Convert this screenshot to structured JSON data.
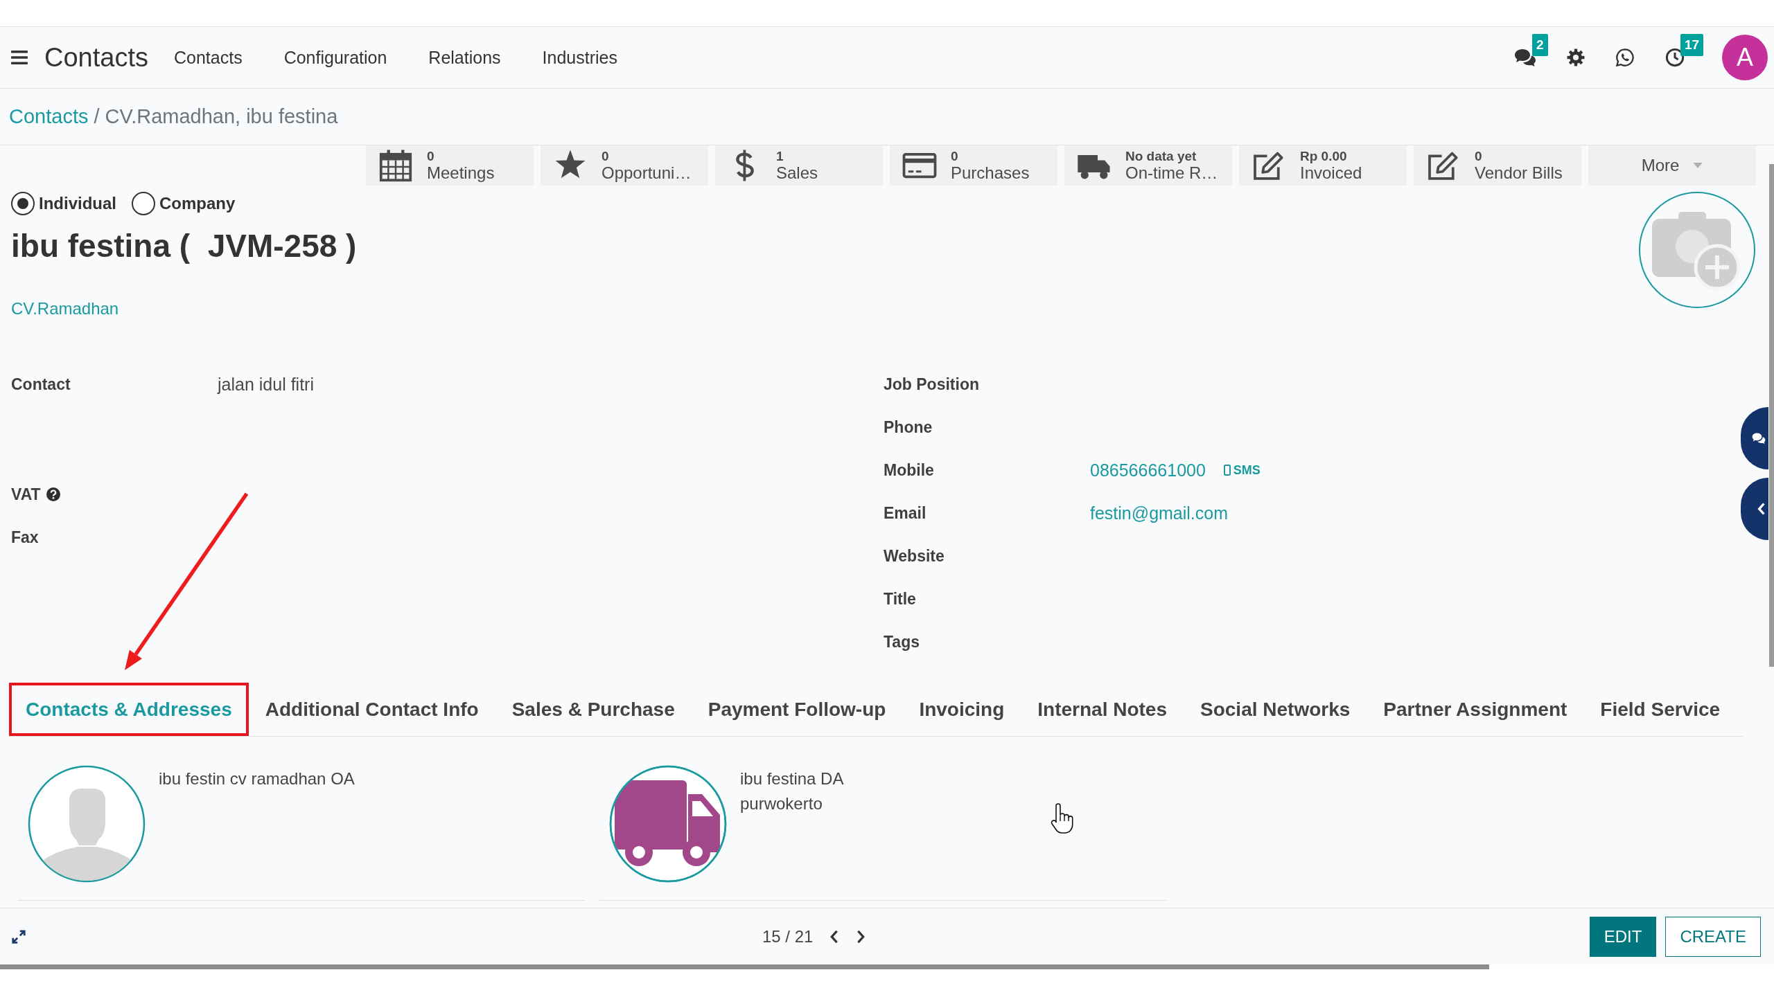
{
  "navbar": {
    "app_name": "Contacts",
    "menu": [
      "Contacts",
      "Configuration",
      "Relations",
      "Industries"
    ],
    "systray": [
      {
        "kind": "messages",
        "badge": "2"
      },
      {
        "kind": "settings"
      },
      {
        "kind": "whatsapp"
      },
      {
        "kind": "activities",
        "badge": "17"
      }
    ],
    "avatar": "A"
  },
  "breadcrumb": {
    "items": [
      {
        "label": "Contacts",
        "kind": "link"
      },
      {
        "label": "CV.Ramadhan, ibu festina",
        "kind": "current"
      }
    ],
    "separator": "/"
  },
  "stat_buttons": [
    {
      "kind": "meetings",
      "value": "0",
      "label": "Meetings"
    },
    {
      "kind": "opportunities",
      "value": "0",
      "label": "Opportuni…"
    },
    {
      "kind": "sales",
      "value": "1",
      "label": "Sales"
    },
    {
      "kind": "purchases",
      "value": "0",
      "label": "Purchases"
    },
    {
      "kind": "on_time",
      "value": "No data yet",
      "label": "On-time R…"
    },
    {
      "kind": "invoiced",
      "value": "Rp 0.00",
      "label": "Invoiced"
    },
    {
      "kind": "vendor_bills",
      "value": "0",
      "label": "Vendor Bills"
    },
    {
      "kind": "more",
      "label": "More"
    }
  ],
  "company_type": [
    {
      "label": "Individual",
      "selected": true
    },
    {
      "label": "Company",
      "selected": false
    }
  ],
  "title": "ibu festina (  JVM-258 )",
  "parent_company": "CV.Ramadhan",
  "fields_left": [
    {
      "kind": "address",
      "label": "Contact",
      "value": "jalan idul fitri",
      "help": false
    },
    {
      "kind": "text",
      "label": "VAT",
      "help": true
    },
    {
      "kind": "text",
      "label": "Fax",
      "help": false
    }
  ],
  "fields_right": [
    {
      "kind": "text",
      "label": "Job Position"
    },
    {
      "kind": "text",
      "label": "Phone"
    },
    {
      "kind": "phone",
      "label": "Mobile",
      "value": "086566661000",
      "action": "SMS"
    },
    {
      "kind": "email",
      "label": "Email",
      "value": "festin@gmail.com"
    },
    {
      "kind": "text",
      "label": "Website"
    },
    {
      "kind": "text",
      "label": "Title"
    },
    {
      "kind": "text",
      "label": "Tags"
    }
  ],
  "tabs": [
    {
      "label": "Contacts & Addresses",
      "selected": true,
      "highlighted": true
    },
    {
      "label": "Additional Contact Info",
      "selected": false,
      "highlighted": false
    },
    {
      "label": "Sales & Purchase",
      "selected": false,
      "highlighted": false
    },
    {
      "label": "Payment Follow-up",
      "selected": false,
      "highlighted": false
    },
    {
      "label": "Invoicing",
      "selected": false,
      "highlighted": false
    },
    {
      "label": "Internal Notes",
      "selected": false,
      "highlighted": false
    },
    {
      "label": "Social Networks",
      "selected": false,
      "highlighted": false
    },
    {
      "label": "Partner Assignment",
      "selected": false,
      "highlighted": false
    },
    {
      "label": "Field Service",
      "selected": false,
      "highlighted": false
    }
  ],
  "contacts": [
    {
      "kind": "person",
      "lines": [
        "ibu festin cv ramadhan OA"
      ]
    },
    {
      "kind": "delivery",
      "lines": [
        "ibu festina DA",
        "purwokerto"
      ]
    }
  ],
  "pager": "15 / 21",
  "actions": [
    {
      "kind": "primary",
      "label": "EDIT"
    },
    {
      "kind": "secondary",
      "label": "CREATE"
    }
  ]
}
